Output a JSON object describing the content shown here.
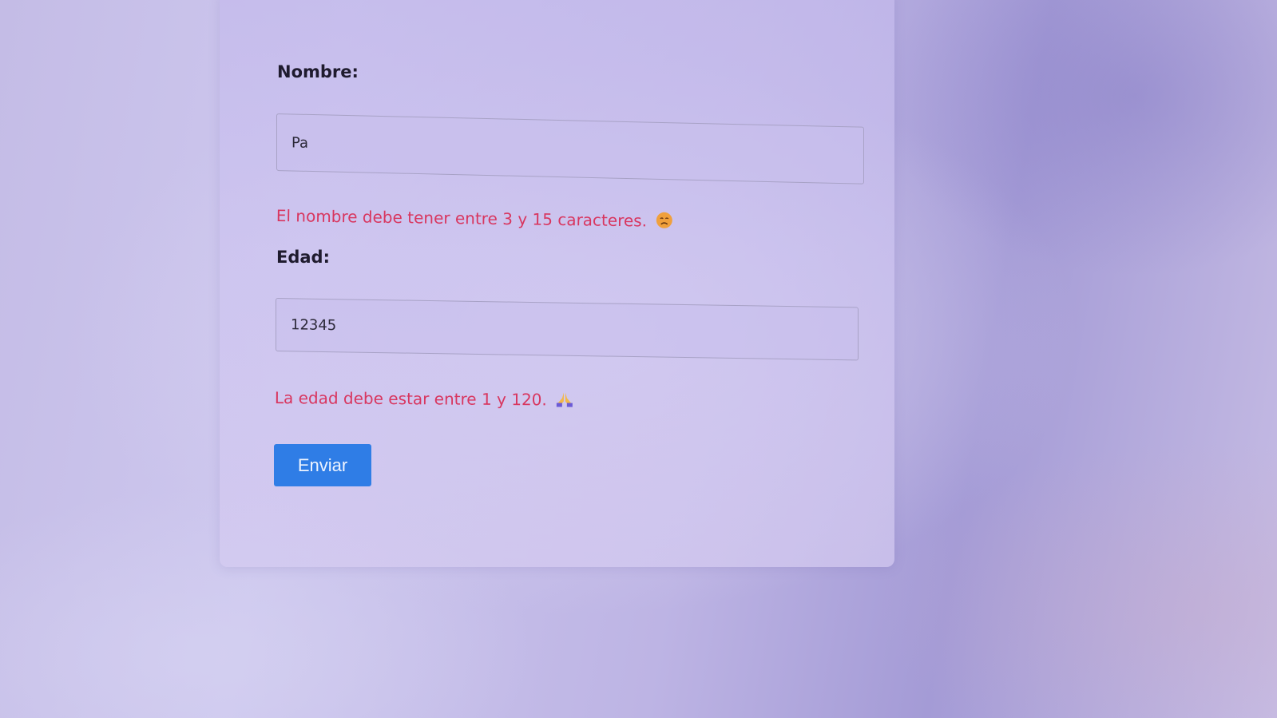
{
  "form": {
    "name_label": "Nombre:",
    "name_value": "Pa",
    "name_error": "El nombre debe tener entre 3 y 15 caracteres.",
    "name_error_icon": "sad-face-emoji",
    "age_label": "Edad:",
    "age_value": "12345",
    "age_error": "La edad debe estar entre 1 y 120.",
    "age_error_icon": "folded-hands-emoji",
    "submit_label": "Enviar"
  },
  "colors": {
    "error_text": "#d8365f",
    "button": "#2f7de6",
    "label_text": "#1f1b2e"
  }
}
